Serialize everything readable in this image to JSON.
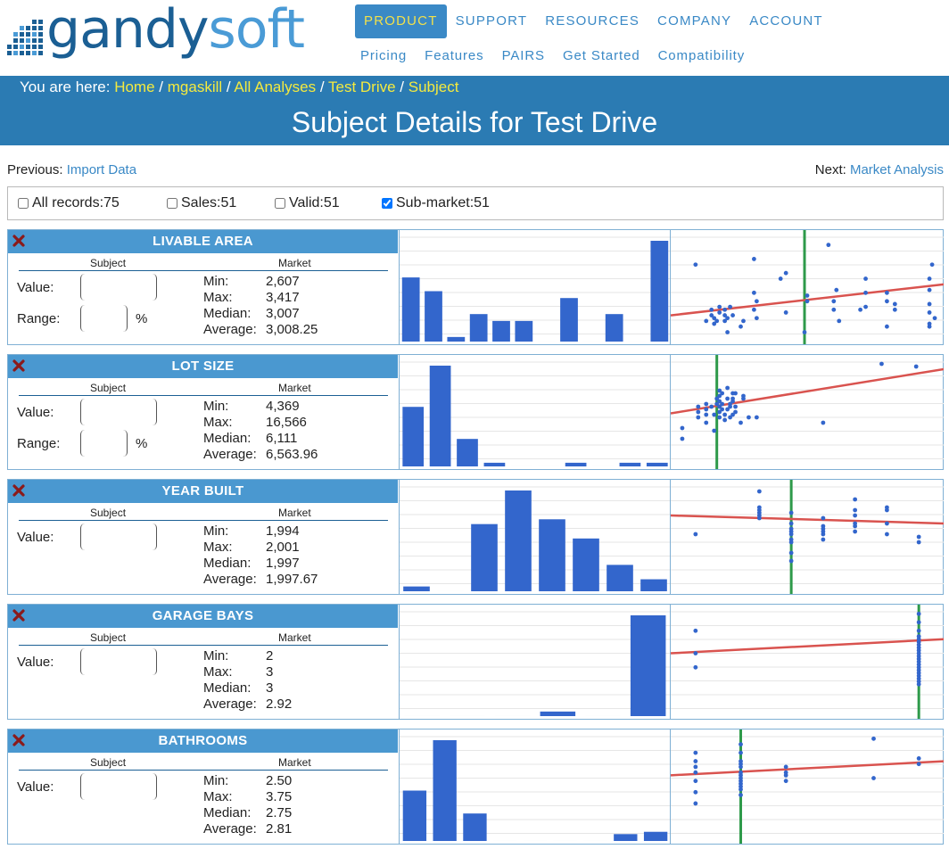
{
  "logo": {
    "brand_part1": "gandy",
    "brand_part2": "soft"
  },
  "topnav": [
    "PRODUCT",
    "SUPPORT",
    "RESOURCES",
    "COMPANY",
    "ACCOUNT"
  ],
  "subnav": [
    "Pricing",
    "Features",
    "PAIRS",
    "Get Started",
    "Compatibility"
  ],
  "breadcrumb": {
    "prefix": "You are here:",
    "items": [
      "Home",
      "mgaskill",
      "All Analyses",
      "Test Drive",
      "Subject"
    ],
    "separator": "/"
  },
  "page_title": "Subject Details for Test Drive",
  "previous": {
    "label": "Previous:",
    "link": "Import Data"
  },
  "next": {
    "label": "Next:",
    "link": "Market Analysis"
  },
  "filters": [
    {
      "label": "All records:75",
      "checked": false
    },
    {
      "label": "Sales:51",
      "checked": false
    },
    {
      "label": "Valid:51",
      "checked": false
    },
    {
      "label": "Sub-market:51",
      "checked": true
    }
  ],
  "labels": {
    "subject": "Subject",
    "market": "Market",
    "value": "Value:",
    "range": "Range:",
    "percent": "%",
    "min": "Min:",
    "max": "Max:",
    "median": "Median:",
    "average": "Average:"
  },
  "colors": {
    "accent": "#3a89c6",
    "banner": "#2b7bb3",
    "panel_header": "#4a98d0",
    "bar": "#3366cc",
    "trend_line": "#d9534f",
    "subject_line": "#2e9a4a",
    "crumb_link": "#f4ea3f"
  },
  "panels": [
    {
      "title": "LIVABLE AREA",
      "has_range": true,
      "stats": {
        "min": "2,607",
        "max": "3,417",
        "median": "3,007",
        "average": "3,008.25"
      },
      "histogram": [
        14,
        11,
        1,
        6,
        4.5,
        4.5,
        0,
        9.5,
        0,
        6,
        0,
        22
      ],
      "scatter": {
        "points": [
          [
            0.08,
            27
          ],
          [
            0.12,
            7
          ],
          [
            0.14,
            9
          ],
          [
            0.14,
            11
          ],
          [
            0.15,
            6
          ],
          [
            0.15,
            8
          ],
          [
            0.16,
            7
          ],
          [
            0.17,
            10
          ],
          [
            0.17,
            12
          ],
          [
            0.19,
            7
          ],
          [
            0.19,
            9
          ],
          [
            0.19,
            11
          ],
          [
            0.2,
            3
          ],
          [
            0.2,
            8
          ],
          [
            0.21,
            12
          ],
          [
            0.22,
            9
          ],
          [
            0.25,
            5
          ],
          [
            0.26,
            7
          ],
          [
            0.3,
            29
          ],
          [
            0.3,
            17
          ],
          [
            0.3,
            11
          ],
          [
            0.31,
            14
          ],
          [
            0.31,
            8
          ],
          [
            0.4,
            22
          ],
          [
            0.42,
            24
          ],
          [
            0.42,
            10
          ],
          [
            0.5,
            16
          ],
          [
            0.5,
            14
          ],
          [
            0.49,
            3
          ],
          [
            0.58,
            34
          ],
          [
            0.6,
            11
          ],
          [
            0.6,
            14
          ],
          [
            0.61,
            18
          ],
          [
            0.62,
            7
          ],
          [
            0.7,
            11
          ],
          [
            0.72,
            17
          ],
          [
            0.72,
            22
          ],
          [
            0.72,
            12
          ],
          [
            0.8,
            17
          ],
          [
            0.8,
            5
          ],
          [
            0.8,
            14
          ],
          [
            0.83,
            13
          ],
          [
            0.83,
            11
          ],
          [
            0.96,
            13
          ],
          [
            0.96,
            5
          ],
          [
            0.96,
            10
          ],
          [
            0.96,
            18
          ],
          [
            0.96,
            22
          ],
          [
            0.96,
            6
          ],
          [
            0.97,
            27
          ],
          [
            0.98,
            8
          ]
        ],
        "trend": [
          [
            0,
            9
          ],
          [
            1,
            20
          ]
        ],
        "subject_x": 0.49,
        "ylim": [
          0,
          38
        ]
      }
    },
    {
      "title": "LOT SIZE",
      "has_range": true,
      "stats": {
        "min": "4,369",
        "max": "16,566",
        "median": "6,111",
        "average": "6,563.96"
      },
      "histogram": [
        13,
        22,
        6,
        0.8,
        0,
        0,
        0.8,
        0,
        0.8,
        0.8
      ],
      "scatter": {
        "points": [
          [
            0.03,
            10
          ],
          [
            0.03,
            14
          ],
          [
            0.09,
            18
          ],
          [
            0.09,
            20
          ],
          [
            0.09,
            22
          ],
          [
            0.12,
            19
          ],
          [
            0.12,
            21
          ],
          [
            0.12,
            23
          ],
          [
            0.12,
            16
          ],
          [
            0.14,
            22
          ],
          [
            0.15,
            13
          ],
          [
            0.15,
            19
          ],
          [
            0.16,
            25
          ],
          [
            0.16,
            23
          ],
          [
            0.17,
            22
          ],
          [
            0.17,
            20
          ],
          [
            0.17,
            26
          ],
          [
            0.17,
            28
          ],
          [
            0.17,
            18
          ],
          [
            0.17,
            24
          ],
          [
            0.18,
            27
          ],
          [
            0.18,
            23
          ],
          [
            0.18,
            21
          ],
          [
            0.19,
            17
          ],
          [
            0.19,
            19
          ],
          [
            0.2,
            21
          ],
          [
            0.2,
            25
          ],
          [
            0.2,
            29
          ],
          [
            0.21,
            18
          ],
          [
            0.21,
            22
          ],
          [
            0.21,
            23
          ],
          [
            0.22,
            27
          ],
          [
            0.22,
            24
          ],
          [
            0.22,
            19
          ],
          [
            0.22,
            25
          ],
          [
            0.23,
            27
          ],
          [
            0.23,
            20
          ],
          [
            0.23,
            22
          ],
          [
            0.25,
            16
          ],
          [
            0.26,
            26
          ],
          [
            0.26,
            25
          ],
          [
            0.28,
            18
          ],
          [
            0.31,
            18
          ],
          [
            0.56,
            16
          ],
          [
            0.78,
            38
          ],
          [
            0.91,
            37
          ]
        ],
        "trend": [
          [
            0,
            19.5
          ],
          [
            1,
            36
          ]
        ],
        "subject_x": 0.16,
        "ylim": [
          0,
          40
        ]
      }
    },
    {
      "title": "YEAR BUILT",
      "has_range": false,
      "stats": {
        "min": "1,994",
        "max": "2,001",
        "median": "1,997",
        "average": "1,997.67"
      },
      "histogram": [
        1,
        0,
        14,
        21,
        15,
        11,
        5.5,
        2.5
      ],
      "scatter": {
        "points": [
          [
            0.08,
            21
          ],
          [
            0.32,
            37
          ],
          [
            0.32,
            31
          ],
          [
            0.32,
            30
          ],
          [
            0.32,
            29
          ],
          [
            0.32,
            28
          ],
          [
            0.32,
            27
          ],
          [
            0.44,
            25
          ],
          [
            0.44,
            23
          ],
          [
            0.44,
            22
          ],
          [
            0.44,
            21
          ],
          [
            0.44,
            19
          ],
          [
            0.44,
            18
          ],
          [
            0.44,
            14
          ],
          [
            0.44,
            11
          ],
          [
            0.44,
            29
          ],
          [
            0.56,
            24
          ],
          [
            0.56,
            23
          ],
          [
            0.56,
            22
          ],
          [
            0.56,
            21
          ],
          [
            0.56,
            27
          ],
          [
            0.56,
            19
          ],
          [
            0.68,
            34
          ],
          [
            0.68,
            30
          ],
          [
            0.68,
            28
          ],
          [
            0.68,
            25
          ],
          [
            0.68,
            24
          ],
          [
            0.68,
            22
          ],
          [
            0.8,
            30
          ],
          [
            0.8,
            25
          ],
          [
            0.8,
            21
          ],
          [
            0.8,
            31
          ],
          [
            0.92,
            20
          ],
          [
            0.92,
            18
          ]
        ],
        "trend": [
          [
            0,
            28
          ],
          [
            1,
            25
          ]
        ],
        "subject_x": 0.44,
        "ylim": [
          0,
          40
        ]
      }
    },
    {
      "title": "GARAGE BAYS",
      "has_range": false,
      "stats": {
        "min": "2",
        "max": "3",
        "median": "3",
        "average": "2.92"
      },
      "histogram": [
        0,
        0,
        0,
        1,
        0,
        22
      ],
      "scatter": {
        "points": [
          [
            0.08,
            30
          ],
          [
            0.08,
            22
          ],
          [
            0.08,
            17
          ],
          [
            0.92,
            36
          ],
          [
            0.92,
            33
          ],
          [
            0.92,
            30
          ],
          [
            0.92,
            28
          ],
          [
            0.92,
            27
          ],
          [
            0.92,
            26
          ],
          [
            0.92,
            25
          ],
          [
            0.92,
            24
          ],
          [
            0.92,
            23
          ],
          [
            0.92,
            22
          ],
          [
            0.92,
            21
          ],
          [
            0.92,
            20
          ],
          [
            0.92,
            19
          ],
          [
            0.92,
            18
          ],
          [
            0.92,
            17
          ],
          [
            0.92,
            16
          ],
          [
            0.92,
            15
          ],
          [
            0.92,
            14
          ],
          [
            0.92,
            13
          ],
          [
            0.92,
            12
          ],
          [
            0.92,
            11
          ]
        ],
        "trend": [
          [
            0,
            22
          ],
          [
            1,
            27
          ]
        ],
        "subject_x": 0.92,
        "ylim": [
          0,
          38
        ]
      }
    },
    {
      "title": "BATHROOMS",
      "has_range": false,
      "stats": {
        "min": "2.50",
        "max": "3.75",
        "median": "2.75",
        "average": "2.81"
      },
      "histogram": [
        11,
        22,
        6,
        0,
        0,
        0,
        0,
        1.5,
        2
      ],
      "scatter": {
        "points": [
          [
            0.08,
            31
          ],
          [
            0.08,
            28
          ],
          [
            0.08,
            26
          ],
          [
            0.08,
            24
          ],
          [
            0.08,
            21
          ],
          [
            0.08,
            17
          ],
          [
            0.08,
            13
          ],
          [
            0.25,
            34
          ],
          [
            0.25,
            31
          ],
          [
            0.25,
            28
          ],
          [
            0.25,
            27
          ],
          [
            0.25,
            26
          ],
          [
            0.25,
            24
          ],
          [
            0.25,
            23
          ],
          [
            0.25,
            22
          ],
          [
            0.25,
            21
          ],
          [
            0.25,
            20
          ],
          [
            0.25,
            19
          ],
          [
            0.25,
            18
          ],
          [
            0.25,
            16
          ],
          [
            0.42,
            26
          ],
          [
            0.42,
            24
          ],
          [
            0.42,
            23
          ],
          [
            0.42,
            21
          ],
          [
            0.75,
            36
          ],
          [
            0.75,
            22
          ],
          [
            0.92,
            29
          ],
          [
            0.92,
            27
          ]
        ],
        "trend": [
          [
            0,
            23
          ],
          [
            1,
            28
          ]
        ],
        "subject_x": 0.25,
        "ylim": [
          0,
          38
        ]
      }
    }
  ]
}
